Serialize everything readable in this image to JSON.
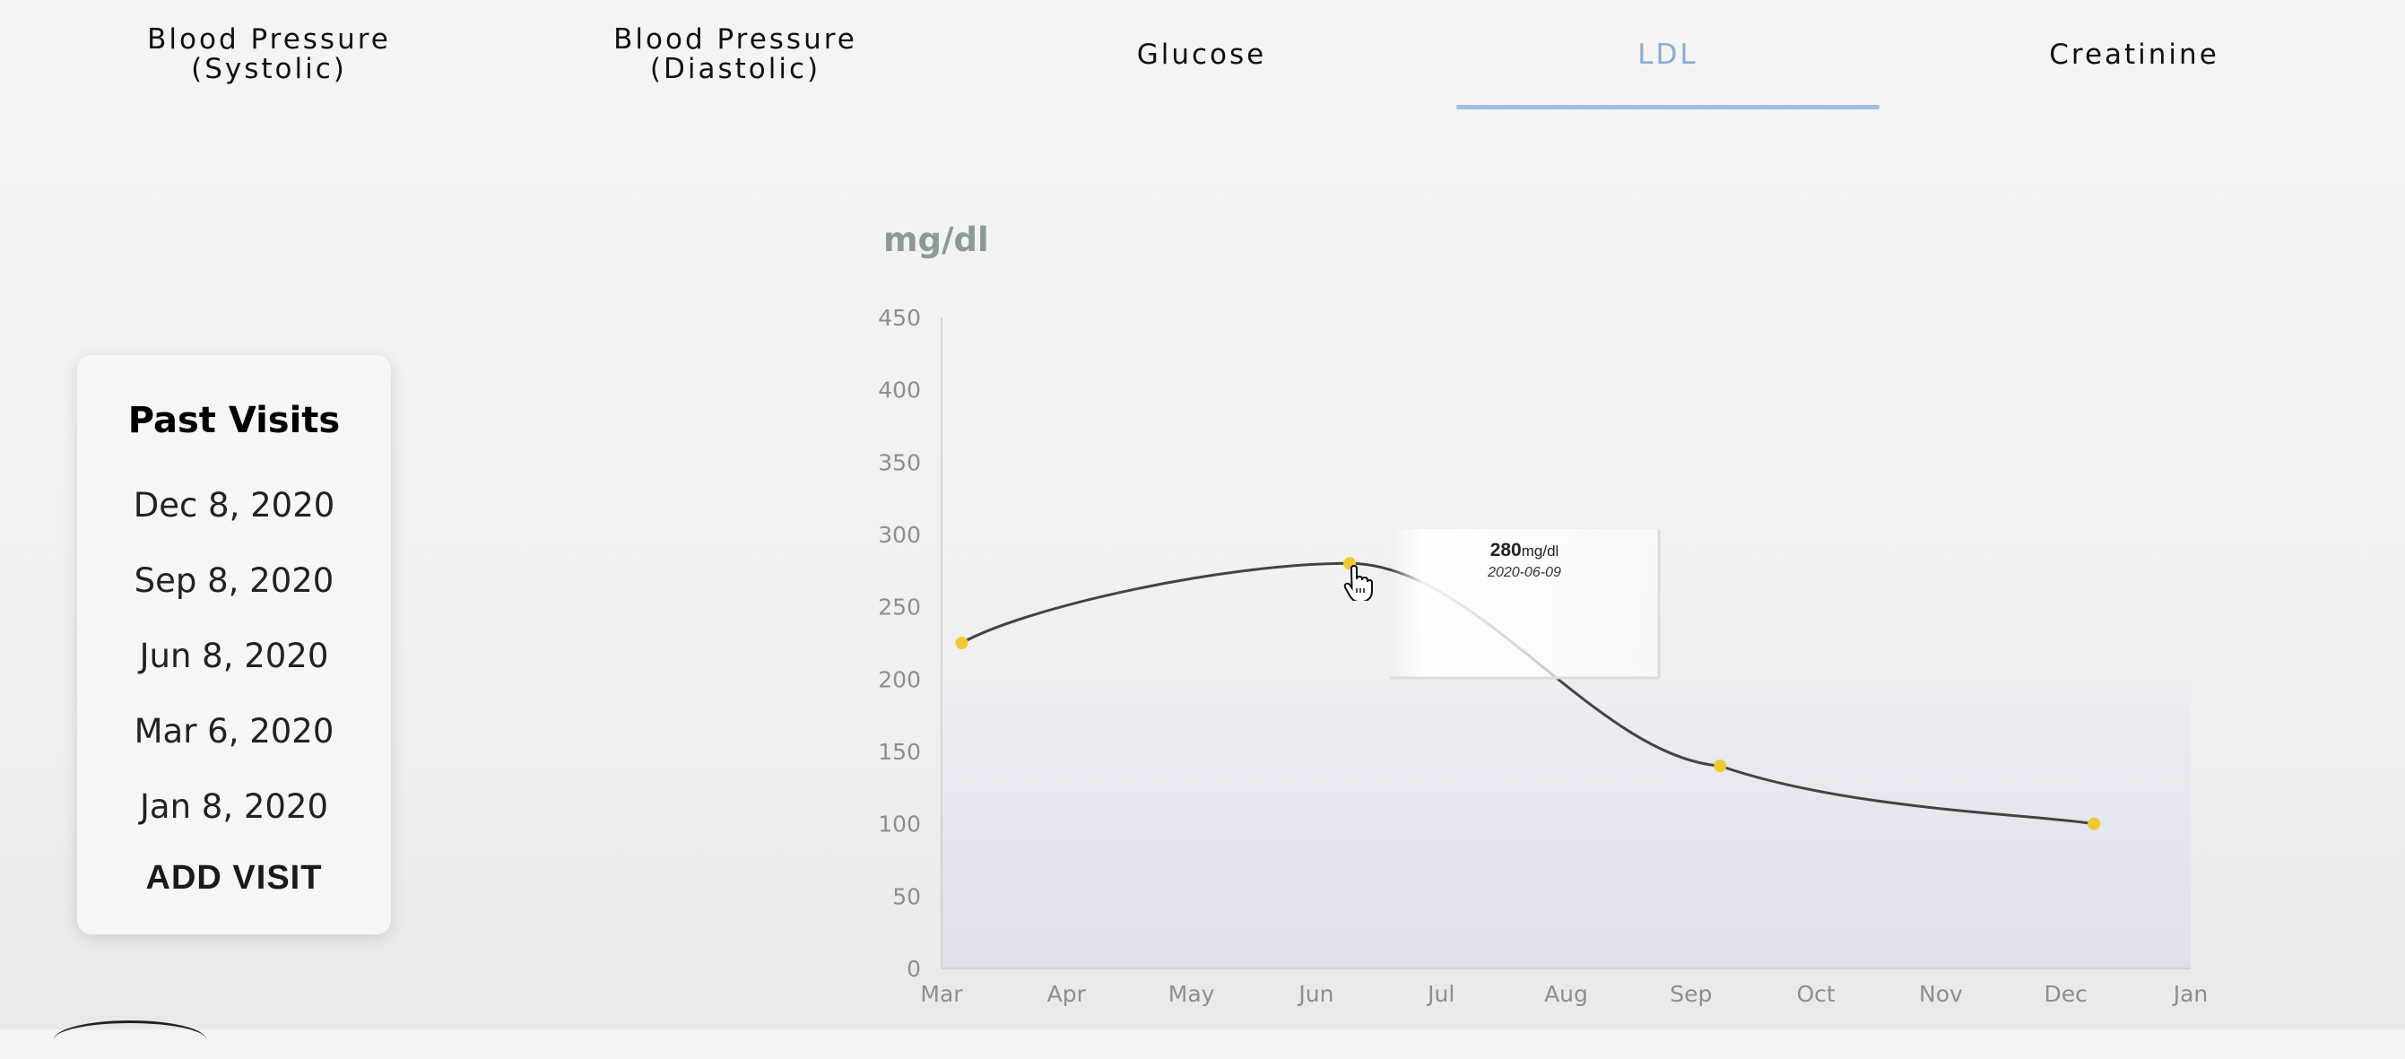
{
  "tabs": [
    {
      "label": "Blood Pressure\n(Systolic)",
      "active": false
    },
    {
      "label": "Blood Pressure\n(Diastolic)",
      "active": false
    },
    {
      "label": "Glucose",
      "active": false
    },
    {
      "label": "LDL",
      "active": true
    },
    {
      "label": "Creatinine",
      "active": false
    }
  ],
  "past_visits": {
    "title": "Past Visits",
    "dates": [
      "Dec 8, 2020",
      "Sep 8, 2020",
      "Jun 8, 2020",
      "Mar 6, 2020",
      "Jan 8, 2020"
    ],
    "add_label": "ADD VISIT"
  },
  "tooltip": {
    "value": "280",
    "unit": "mg/dl",
    "date": "2020-06-09"
  },
  "colors": {
    "accent": "#8eaad6",
    "point": "#f0c832",
    "line": "#444444",
    "band": "#dde1ea"
  },
  "chart_data": {
    "type": "line",
    "ylabel": "mg/dl",
    "y_ticks": [
      "0",
      "50",
      "100",
      "150",
      "200",
      "250",
      "300",
      "350",
      "400",
      "450"
    ],
    "x_ticks": [
      "Mar",
      "Apr",
      "May",
      "Jun",
      "Jul",
      "Aug",
      "Sep",
      "Oct",
      "Nov",
      "Dec",
      "Jan"
    ],
    "ylim": [
      0,
      450
    ],
    "x_range_months": [
      0,
      10
    ],
    "series": [
      {
        "points": [
          {
            "date": "2020-03-06",
            "y": 225
          },
          {
            "date": "2020-06-09",
            "y": 280
          },
          {
            "date": "2020-09-08",
            "y": 140
          },
          {
            "date": "2020-12-08",
            "y": 100
          }
        ]
      }
    ],
    "target_band": {
      "from": 0,
      "to": 200
    },
    "grid": false
  }
}
